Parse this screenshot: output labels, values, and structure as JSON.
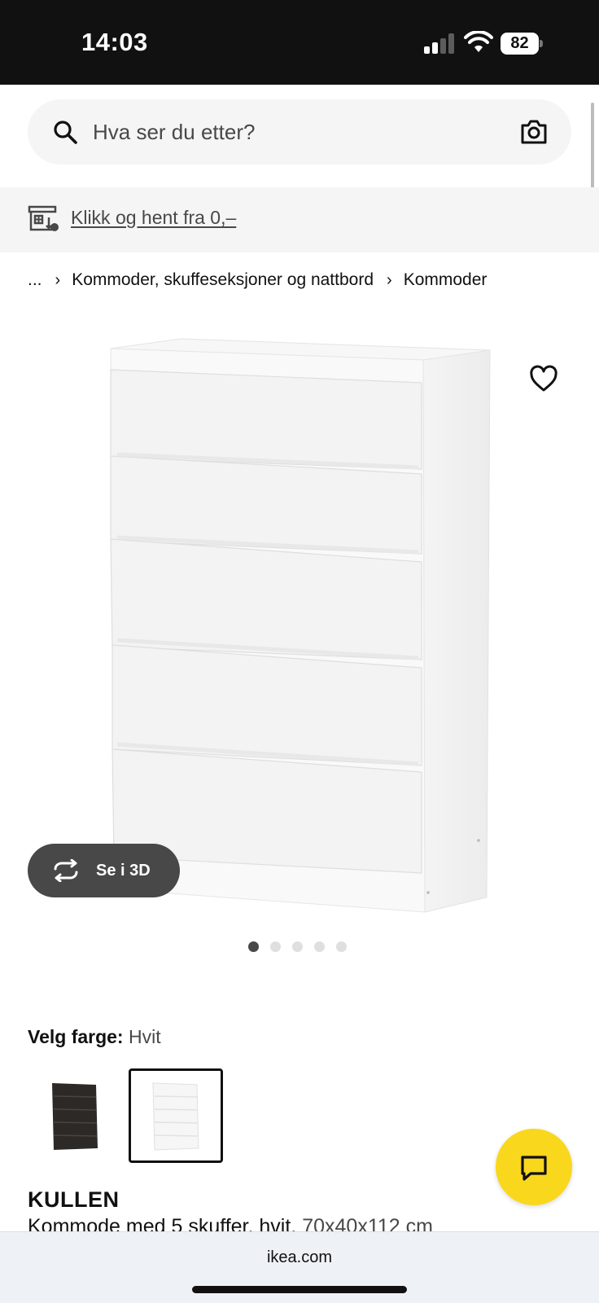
{
  "status_bar": {
    "time": "14:03",
    "battery_level": "82"
  },
  "search": {
    "placeholder": "Hva ser du etter?"
  },
  "pickup_banner": {
    "link_text": "Klikk og hent fra 0,–"
  },
  "breadcrumb": {
    "ellipsis": "...",
    "items": [
      "Kommoder, skuffeseksjoner og nattbord",
      "Kommoder"
    ]
  },
  "gallery": {
    "view_3d_label": "Se i 3D",
    "image_count": 5,
    "active_image": 1
  },
  "color_selector": {
    "label": "Velg farge:",
    "selected_value": "Hvit",
    "swatches": [
      {
        "name": "black-brown",
        "selected": false
      },
      {
        "name": "white",
        "selected": true
      }
    ]
  },
  "product": {
    "name": "KULLEN",
    "description": "Kommode med 5 skuffer, hvit,",
    "dimensions": "70x40x112 cm"
  },
  "browser": {
    "url": "ikea.com"
  },
  "colors": {
    "brand_yellow": "#f9d71c",
    "text_dark": "#111111",
    "text_muted": "#484848",
    "surface": "#f5f5f5"
  },
  "icons": [
    "search-icon",
    "camera-icon",
    "store-icon",
    "chevron-right-icon",
    "heart-icon",
    "rotate-3d-icon",
    "chat-icon",
    "signal-icon",
    "wifi-icon",
    "battery-icon"
  ]
}
